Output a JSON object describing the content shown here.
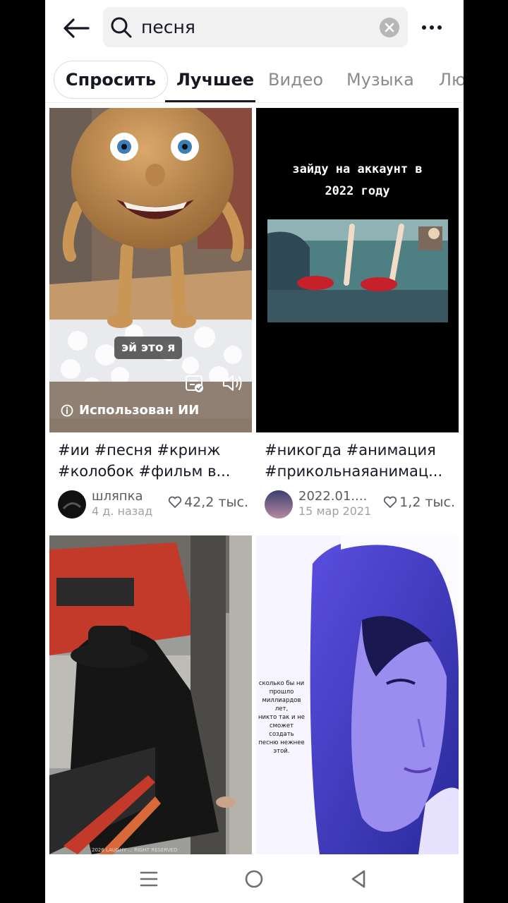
{
  "search": {
    "query": "песня"
  },
  "tabs": [
    {
      "label": "Спросить"
    },
    {
      "label": "Лучшее"
    },
    {
      "label": "Видео"
    },
    {
      "label": "Музыка"
    },
    {
      "label": "Лю"
    }
  ],
  "cards": [
    {
      "overlay_text": "эй это я",
      "ai_label": "Использован ИИ",
      "caption_line1": "#ии #песня #кринж",
      "caption_line2": "#колобок #фильм в...",
      "username": "шляпка",
      "date": "4 д. назад",
      "likes": "42,2 тыс."
    },
    {
      "overlay_text_line1": "зайду на аккаунт в",
      "overlay_text_line2": "2022 году",
      "caption_line1": "#никогда #анимация",
      "caption_line2": "#прикольнаяанимац...",
      "username": "2022.01....",
      "date": "15 мар 2021",
      "likes": "1,2 тыс."
    },
    {
      "watermark": "2026 LAUGHY ... RIGHT RESERVED"
    },
    {
      "overlay_text": [
        "сколько бы ни",
        "прошло",
        "миллиардов лет,",
        "никто так и не",
        "сможет создать",
        "песню нежнее",
        "этой."
      ]
    }
  ],
  "colors": {
    "text": "#161823",
    "muted": "#8a8b91",
    "search_bg": "#f1f1f2"
  },
  "icons": [
    "back-arrow-icon",
    "search-icon",
    "clear-icon",
    "more-icon",
    "info-icon",
    "caption-icon",
    "volume-icon",
    "heart-icon",
    "menu-icon",
    "home-circle-icon",
    "back-triangle-icon"
  ]
}
